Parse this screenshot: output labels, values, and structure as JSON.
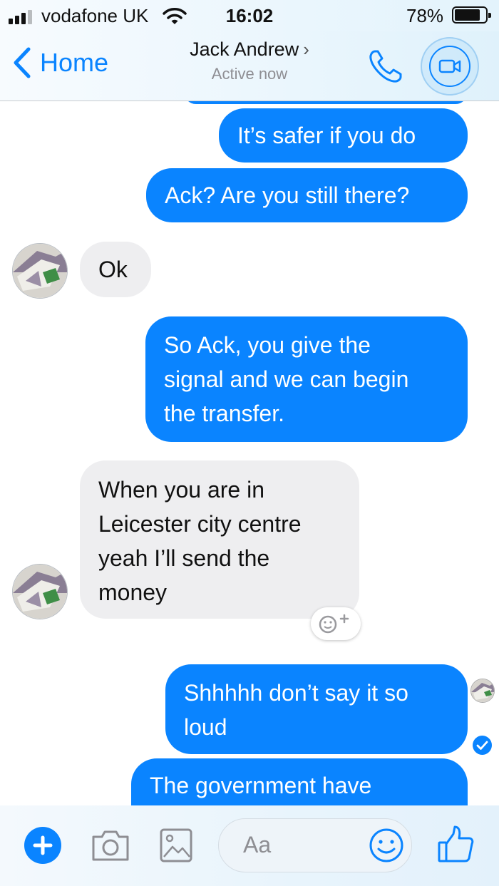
{
  "status_bar": {
    "carrier": "vodafone UK",
    "time": "16:02",
    "battery_percent": "78%"
  },
  "header": {
    "back_label": "Home",
    "contact_name": "Jack Andrew",
    "contact_status": "Active now"
  },
  "messages": [
    {
      "direction": "outgoing",
      "lines": [
        "It’s safer if you do"
      ]
    },
    {
      "direction": "outgoing",
      "lines": [
        "Ack? Are you still there?"
      ]
    },
    {
      "direction": "incoming",
      "lines": [
        "Ok"
      ]
    },
    {
      "direction": "outgoing",
      "lines": [
        "So Ack, you give the",
        "signal and we can begin",
        "the transfer."
      ]
    },
    {
      "direction": "incoming",
      "lines": [
        "When you are in",
        "Leicester city centre",
        "yeah I’ll send the",
        "money"
      ]
    },
    {
      "direction": "outgoing",
      "lines": [
        "Shhhhh don’t say it so",
        "loud"
      ]
    },
    {
      "direction": "outgoing",
      "lines": [
        "The government have"
      ]
    }
  ],
  "composer": {
    "placeholder": "Aa"
  },
  "colors": {
    "accent": "#0a84ff",
    "incoming_bubble": "#eeeef0"
  }
}
